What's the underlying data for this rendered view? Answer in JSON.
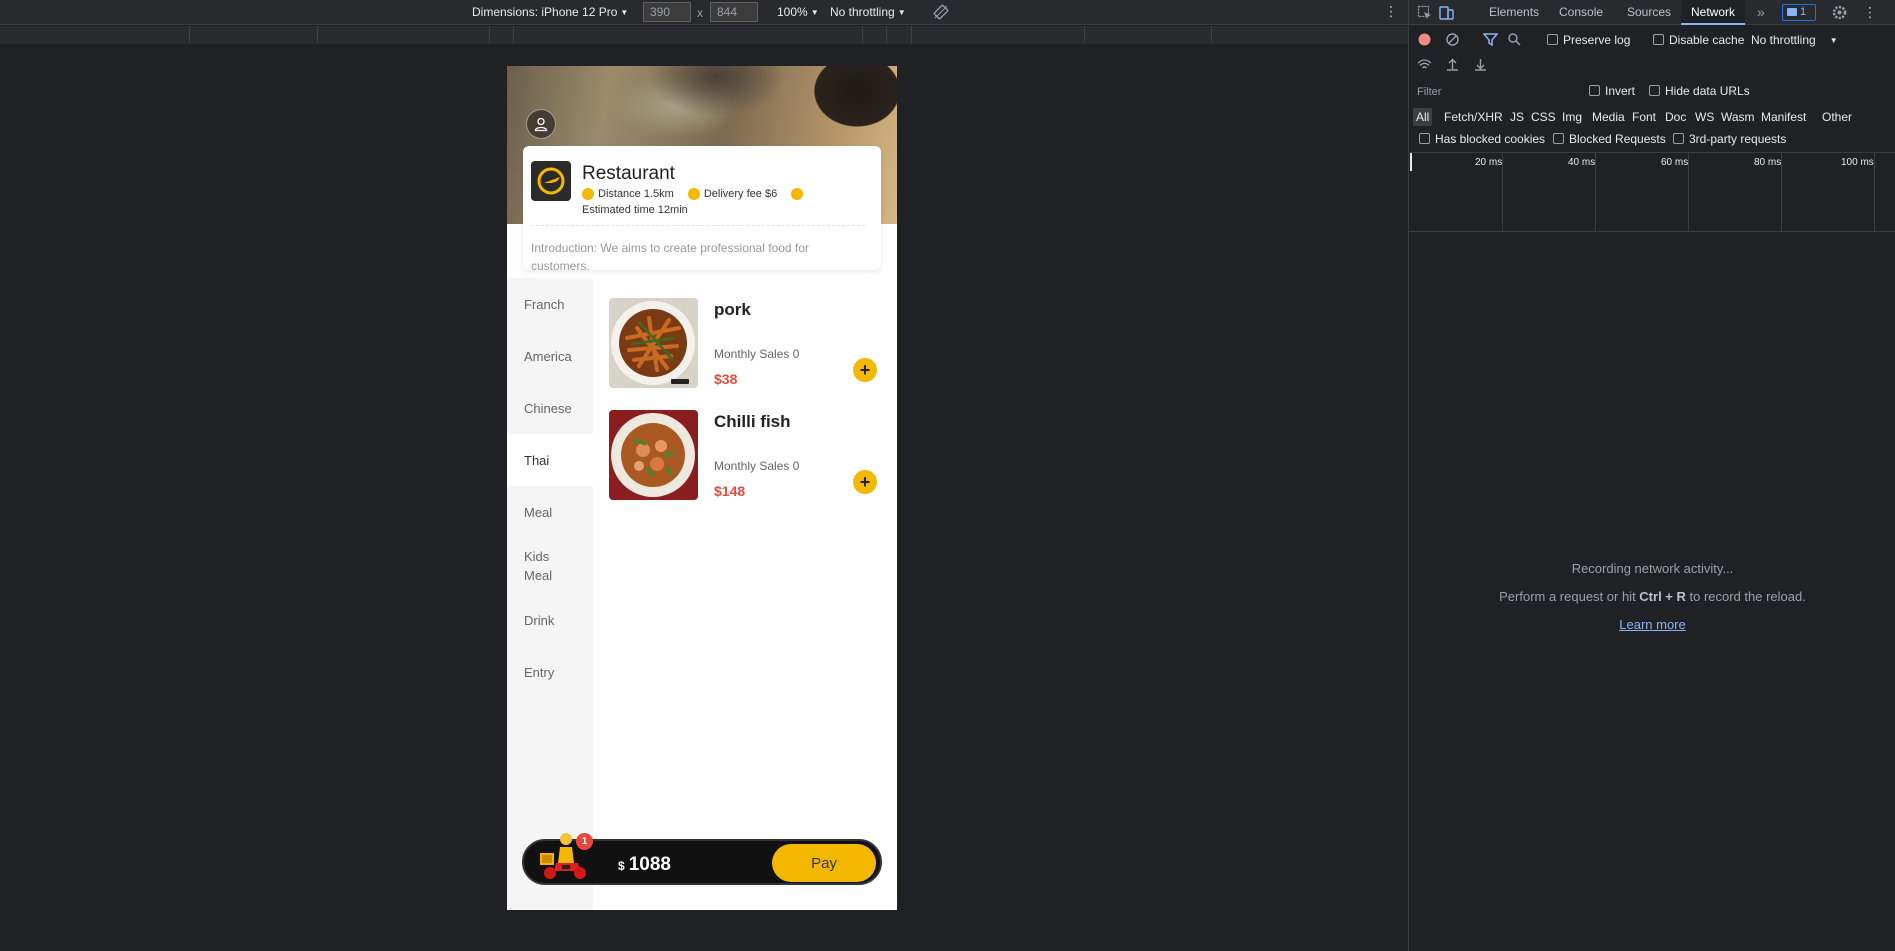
{
  "device_toolbar": {
    "dimensions_label": "Dimensions: iPhone 12 Pro",
    "width_value": "390",
    "height_value": "844",
    "separator": "x",
    "zoom": "100%",
    "throttling": "No throttling",
    "more_icon": "⋮"
  },
  "app": {
    "shop": {
      "name": "Restaurant",
      "distance": "Distance 1.5km",
      "delivery_fee": "Delivery fee $6",
      "estimated_time": "Estimated time 12min",
      "introduction": "Introduction: We aims to create professional food for customers."
    },
    "categories": [
      {
        "label": "Franch"
      },
      {
        "label": "America"
      },
      {
        "label": "Chinese"
      },
      {
        "label": "Thai"
      },
      {
        "label": "Meal"
      },
      {
        "label": "Kids Meal"
      },
      {
        "label": "Drink"
      },
      {
        "label": "Entry"
      }
    ],
    "active_category": "Thai",
    "dishes": [
      {
        "name": "pork",
        "sales": "Monthly Sales 0",
        "price": "$38"
      },
      {
        "name": "Chilli fish",
        "sales": "Monthly Sales 0",
        "price": "$148"
      }
    ],
    "cart": {
      "count": "1",
      "currency": "$",
      "total": "1088",
      "pay_label": "Pay"
    },
    "colors": {
      "accent": "#f5b800",
      "price": "#e84b3c",
      "cart_bg": "#111111"
    }
  },
  "devtools": {
    "tabs": [
      "Elements",
      "Console",
      "Sources",
      "Network"
    ],
    "active_tab": "Network",
    "issues_count": "1",
    "preserve_log": "Preserve log",
    "disable_cache": "Disable cache",
    "throttling": "No throttling",
    "filter_placeholder": "Filter",
    "invert": "Invert",
    "hide_data_urls": "Hide data URLs",
    "resource_types": [
      "All",
      "Fetch/XHR",
      "JS",
      "CSS",
      "Img",
      "Media",
      "Font",
      "Doc",
      "WS",
      "Wasm",
      "Manifest",
      "Other"
    ],
    "has_blocked_cookies": "Has blocked cookies",
    "blocked_requests": "Blocked Requests",
    "third_party": "3rd-party requests",
    "timeline_labels": [
      "20 ms",
      "40 ms",
      "60 ms",
      "80 ms",
      "100 ms"
    ],
    "recording": "Recording network activity...",
    "hint_prefix": "Perform a request or hit ",
    "hint_keys": "Ctrl + R",
    "hint_suffix": " to record the reload.",
    "learn_more": "Learn more"
  }
}
